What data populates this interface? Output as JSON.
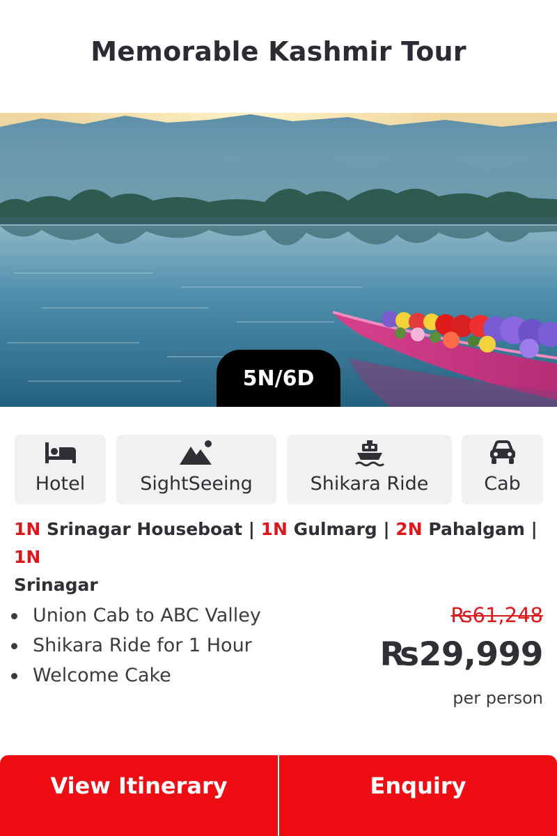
{
  "package": {
    "title": "Memorable Kashmir Tour",
    "duration": "5N/6D",
    "image_alt": "Dal Lake with shikara boat full of flowers"
  },
  "features": [
    {
      "label": "Hotel",
      "icon": "bed-icon"
    },
    {
      "label": "SightSeeing",
      "icon": "mountain-icon"
    },
    {
      "label": "Shikara Ride",
      "icon": "boat-icon"
    },
    {
      "label": "Cab",
      "icon": "car-icon"
    }
  ],
  "route": [
    {
      "nights": "1N",
      "place": "Srinagar Houseboat"
    },
    {
      "nights": "1N",
      "place": "Gulmarg"
    },
    {
      "nights": "2N",
      "place": "Pahalgam"
    },
    {
      "nights": "1N",
      "place": "Srinagar"
    }
  ],
  "route_separator": "|",
  "inclusions": [
    "Union Cab to ABC Valley",
    "Shikara Ride for 1 Hour",
    "Welcome Cake"
  ],
  "pricing": {
    "original_price": "₨61,248",
    "price": "₨29,999",
    "unit": "per person"
  },
  "actions": {
    "itinerary_label": "View Itinerary",
    "enquiry_label": "Enquiry"
  },
  "colors": {
    "accent": "#ee0d12",
    "text": "#2f3035",
    "badge_bg": "#000000",
    "feature_bg": "#f1f1f2"
  }
}
